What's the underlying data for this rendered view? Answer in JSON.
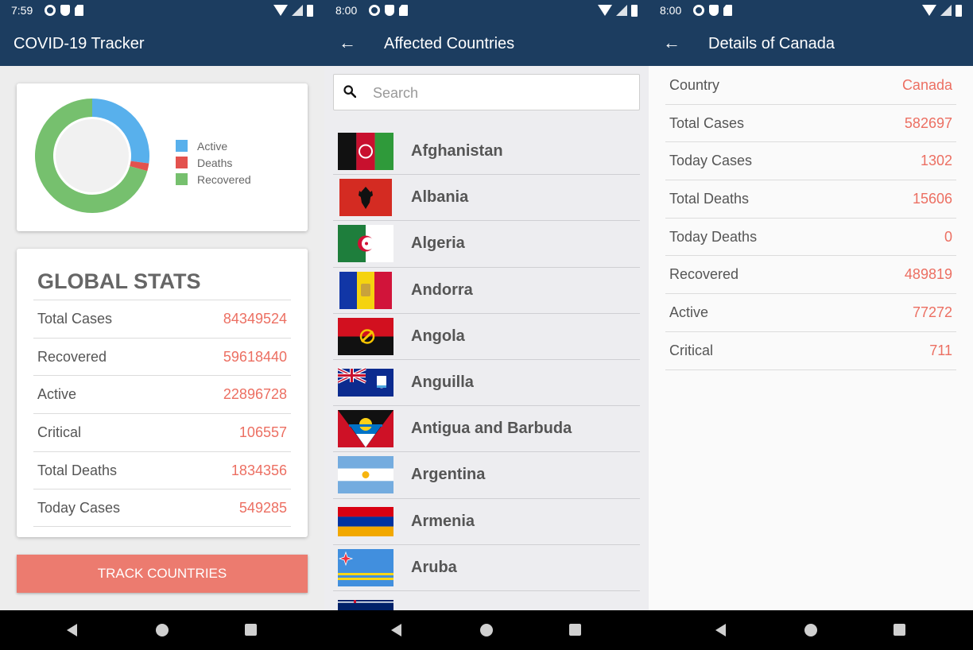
{
  "screen1": {
    "status_time": "7:59",
    "title": "COVID-19 Tracker",
    "legend": [
      {
        "label": "Active",
        "color": "#58b0ec"
      },
      {
        "label": "Deaths",
        "color": "#e3524e"
      },
      {
        "label": "Recovered",
        "color": "#76c06e"
      }
    ],
    "stats_title": "GLOBAL STATS",
    "stats": [
      {
        "label": "Total Cases",
        "value": "84349524"
      },
      {
        "label": "Recovered",
        "value": "59618440"
      },
      {
        "label": "Active",
        "value": "22896728"
      },
      {
        "label": "Critical",
        "value": "106557"
      },
      {
        "label": "Total Deaths",
        "value": "1834356"
      },
      {
        "label": "Today Cases",
        "value": "549285"
      }
    ],
    "track_button": "TRACK COUNTRIES"
  },
  "chart_data": {
    "type": "pie",
    "categories": [
      "Active",
      "Deaths",
      "Recovered"
    ],
    "values": [
      22896728,
      1834356,
      59618440
    ],
    "colors": [
      "#58b0ec",
      "#e3524e",
      "#76c06e"
    ],
    "legend": "right"
  },
  "screen2": {
    "status_time": "8:00",
    "title": "Affected Countries",
    "search_placeholder": "Search",
    "countries": [
      {
        "name": "Afghanistan"
      },
      {
        "name": "Albania"
      },
      {
        "name": "Algeria"
      },
      {
        "name": "Andorra"
      },
      {
        "name": "Angola"
      },
      {
        "name": "Anguilla"
      },
      {
        "name": "Antigua and Barbuda"
      },
      {
        "name": "Argentina"
      },
      {
        "name": "Armenia"
      },
      {
        "name": "Aruba"
      },
      {
        "name": ""
      }
    ]
  },
  "screen3": {
    "status_time": "8:00",
    "title": "Details of Canada",
    "details": [
      {
        "label": "Country",
        "value": "Canada"
      },
      {
        "label": "Total Cases",
        "value": "582697"
      },
      {
        "label": "Today Cases",
        "value": "1302"
      },
      {
        "label": "Total Deaths",
        "value": "15606"
      },
      {
        "label": "Today Deaths",
        "value": "0"
      },
      {
        "label": "Recovered",
        "value": "489819"
      },
      {
        "label": "Active",
        "value": "77272"
      },
      {
        "label": "Critical",
        "value": "711"
      }
    ]
  },
  "colors": {
    "primary": "#1c3d60",
    "accent": "#ec6f62",
    "button": "#ec7b6f"
  }
}
